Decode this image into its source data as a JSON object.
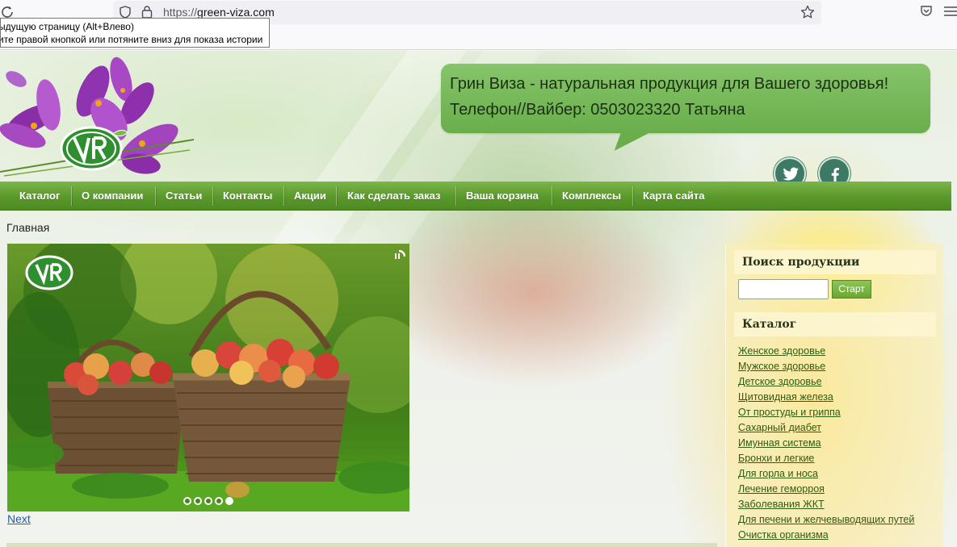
{
  "browser": {
    "url_prefix": "https://",
    "url_domain": "green-viza.com",
    "tooltip_line1": "ыдущую страницу (Alt+Влево)",
    "tooltip_line2": "ите правой кнопкой или потяните вниз для показа истории",
    "icons": [
      "reload-icon",
      "shield-icon",
      "lock-icon",
      "star-icon",
      "pocket-icon",
      "menu-icon"
    ]
  },
  "header": {
    "tagline": "Грин Виза - натуральная продукция для Вашего здоровья!",
    "phone": "Телефон//Вайбер: 0503023320 Татьяна",
    "social": [
      "twitter-icon",
      "facebook-icon"
    ]
  },
  "nav": {
    "items": [
      {
        "label": "Каталог"
      },
      {
        "label": "О компании"
      },
      {
        "label": "Статьи"
      },
      {
        "label": "Контакты"
      },
      {
        "label": "Акции"
      },
      {
        "label": "Как сделать заказ"
      },
      {
        "label": "Ваша корзина"
      },
      {
        "label": "Комплексы"
      },
      {
        "label": "Карта сайта"
      }
    ]
  },
  "breadcrumb": "Главная",
  "slider": {
    "dot_count": 5,
    "active_dot": 5,
    "next_label": "Next"
  },
  "sidebar": {
    "search_title": "Поиск продукции",
    "search_value": "",
    "search_button": "Старт",
    "catalog_title": "Каталог",
    "categories": [
      "Женское здоровье",
      "Мужское здоровье",
      "Детское здоровье",
      "Щитовидная железа",
      "От простуды и гриппа",
      "Сахарный диабет",
      "Имунная система",
      "Бронхи и легкие",
      "Для горла и носа",
      "Лечение геморроя",
      "Заболевания ЖКТ",
      "Для печени и желчевыводящих путей",
      "Очистка организма"
    ]
  },
  "colors": {
    "nav_green": "#5b982c",
    "bubble_green": "#7ab85d",
    "link_green": "#2f5b12",
    "social_teal": "#3c7a66"
  }
}
